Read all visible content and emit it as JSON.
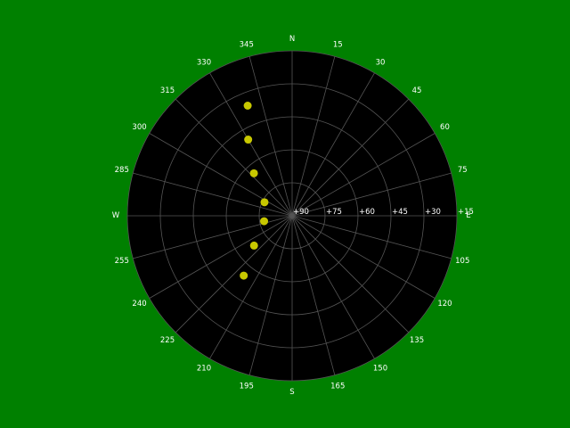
{
  "colors": {
    "background": "#008000",
    "plot_face": "#000000",
    "grid": "#555555",
    "marker": "#c8c800",
    "text": "#ffffff"
  },
  "chart_data": {
    "type": "scatter",
    "projection": "polar",
    "title": "",
    "theta_zero_location": "N",
    "theta_direction": "counterclockwise",
    "angular_tick_labels": [
      {
        "angle": 0,
        "label": "E"
      },
      {
        "angle": 15,
        "label": "75"
      },
      {
        "angle": 30,
        "label": "60"
      },
      {
        "angle": 45,
        "label": "45"
      },
      {
        "angle": 60,
        "label": "30"
      },
      {
        "angle": 75,
        "label": "15"
      },
      {
        "angle": 90,
        "label": "N"
      },
      {
        "angle": 105,
        "label": "345"
      },
      {
        "angle": 120,
        "label": "330"
      },
      {
        "angle": 135,
        "label": "315"
      },
      {
        "angle": 150,
        "label": "300"
      },
      {
        "angle": 165,
        "label": "285"
      },
      {
        "angle": 180,
        "label": "W"
      },
      {
        "angle": 195,
        "label": "255"
      },
      {
        "angle": 210,
        "label": "240"
      },
      {
        "angle": 225,
        "label": "225"
      },
      {
        "angle": 240,
        "label": "210"
      },
      {
        "angle": 255,
        "label": "195"
      },
      {
        "angle": 270,
        "label": "S"
      },
      {
        "angle": 285,
        "label": "165"
      },
      {
        "angle": 300,
        "label": "150"
      },
      {
        "angle": 315,
        "label": "135"
      },
      {
        "angle": 330,
        "label": "120"
      },
      {
        "angle": 345,
        "label": "105"
      }
    ],
    "radial_axis": {
      "rlim": [
        90,
        15
      ],
      "ticks": [
        90,
        75,
        60,
        45,
        30,
        15
      ],
      "tick_labels": [
        "+90",
        "+75",
        "+60",
        "+45",
        "+30",
        "+15"
      ],
      "label_angle": 90
    },
    "grid": true,
    "series": [
      {
        "marker": "circle",
        "color": "#c8c800",
        "points": [
          {
            "azimuth": 112,
            "elevation": 36
          },
          {
            "azimuth": 120,
            "elevation": 50
          },
          {
            "azimuth": 132,
            "elevation": 64
          },
          {
            "azimuth": 154,
            "elevation": 76
          },
          {
            "azimuth": 191,
            "elevation": 77
          },
          {
            "azimuth": 218,
            "elevation": 68
          },
          {
            "azimuth": 231,
            "elevation": 55
          }
        ]
      }
    ]
  }
}
